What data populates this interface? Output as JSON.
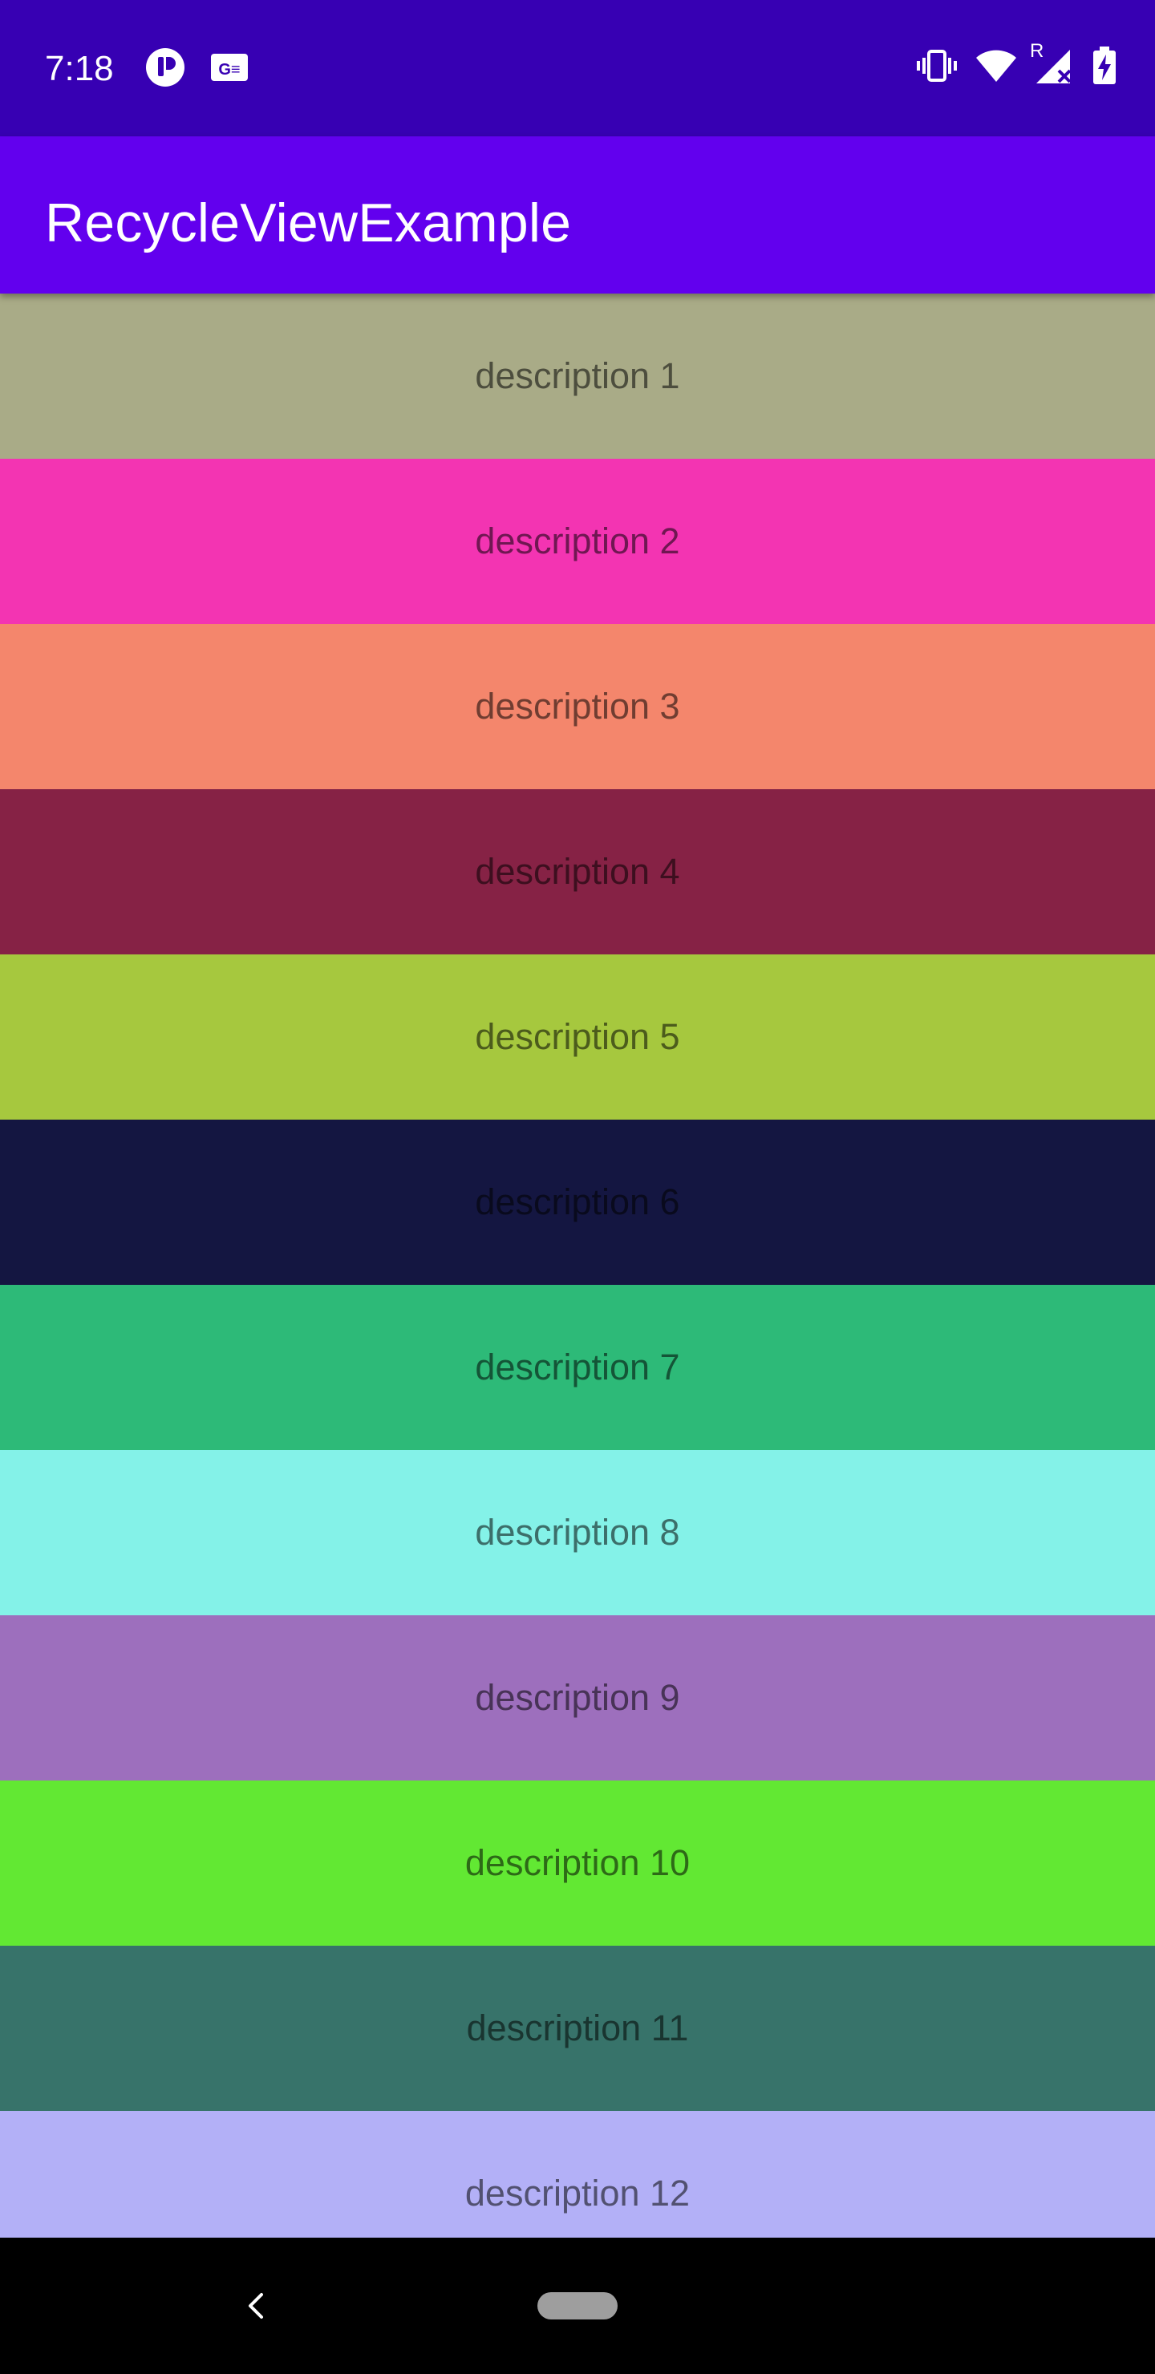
{
  "status_bar": {
    "time": "7:18",
    "left_icons": [
      "app-notification-icon",
      "news-notification-icon"
    ],
    "right_icons": [
      "vibrate-icon",
      "wifi-icon",
      "signal-roaming-icon",
      "battery-charging-icon"
    ],
    "roaming_label": "R",
    "background": "#3700b3"
  },
  "app_bar": {
    "title": "RecycleViewExample",
    "background": "#6200ee"
  },
  "list": {
    "items": [
      {
        "label": "description 1",
        "color": "#a9ab87"
      },
      {
        "label": "description 2",
        "color": "#f334b2"
      },
      {
        "label": "description 3",
        "color": "#f4866c"
      },
      {
        "label": "description 4",
        "color": "#862245"
      },
      {
        "label": "description 5",
        "color": "#a6c83e"
      },
      {
        "label": "description 6",
        "color": "#141641"
      },
      {
        "label": "description 7",
        "color": "#2dba78"
      },
      {
        "label": "description 8",
        "color": "#84f2e8"
      },
      {
        "label": "description 9",
        "color": "#9d6fbd"
      },
      {
        "label": "description 10",
        "color": "#62e833"
      },
      {
        "label": "description 11",
        "color": "#37736a"
      },
      {
        "label": "description 12",
        "color": "#b3b0f7"
      }
    ]
  },
  "nav_bar": {
    "icons": [
      "back-icon",
      "home-pill-icon"
    ]
  }
}
